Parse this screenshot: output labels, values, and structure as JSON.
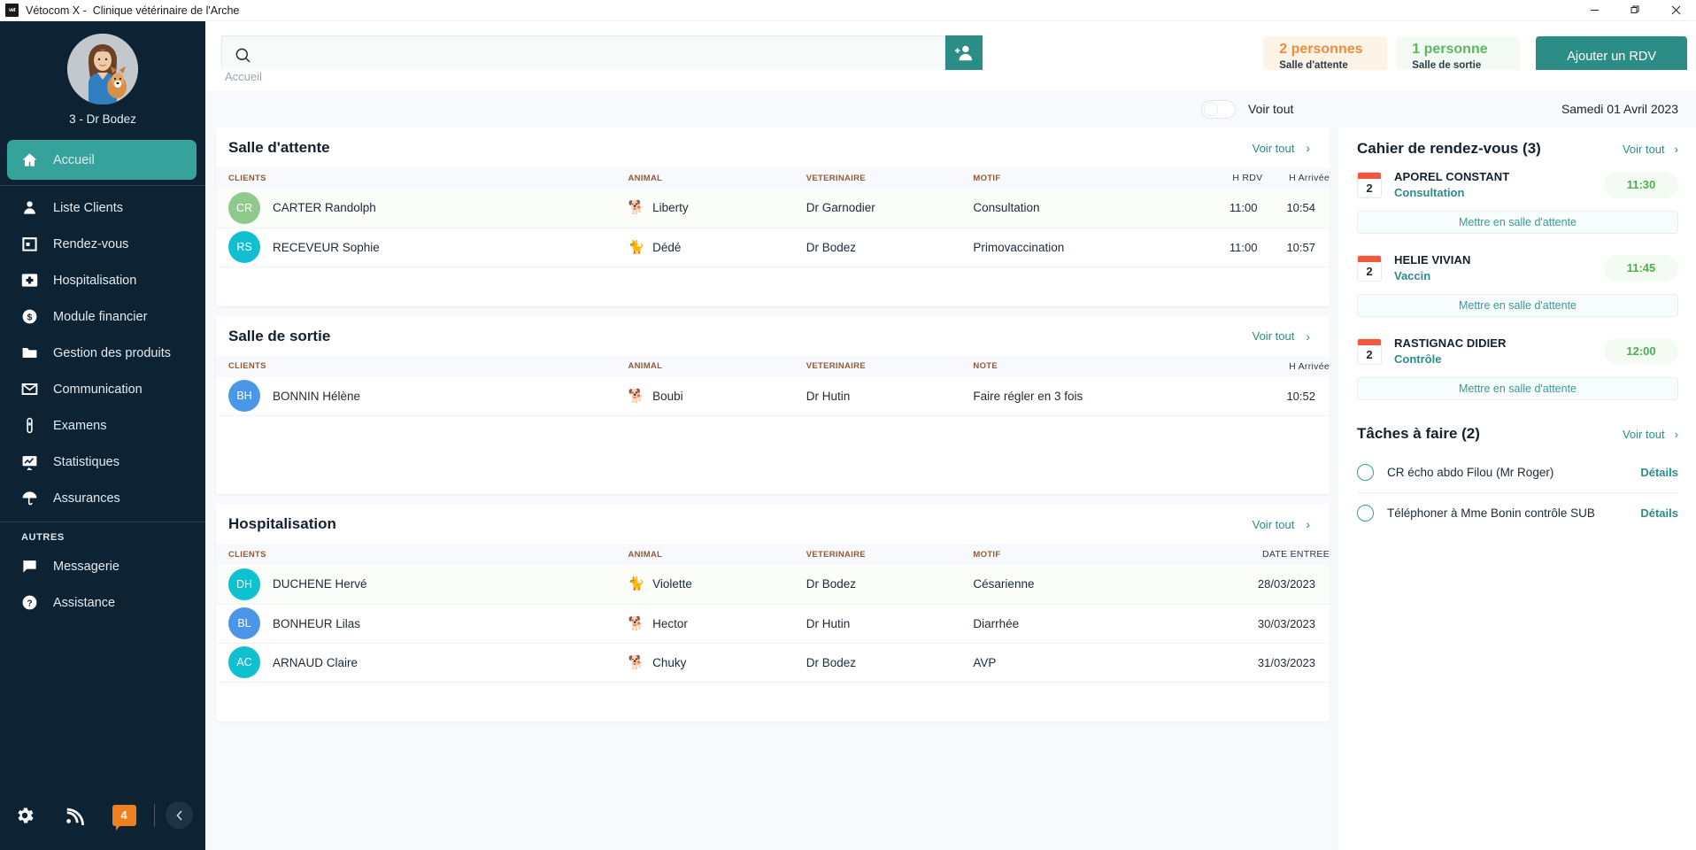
{
  "window": {
    "app_name": "Vétocom X - ",
    "clinic": "Clinique vétérinaire de l'Arche",
    "title": "Vétocom X -  Clinique vétérinaire de l'Arche",
    "logo_text": "vet",
    "minimize": "—",
    "maximize": "❐",
    "close": "✕"
  },
  "sidebar": {
    "profile": {
      "name": "3 - Dr Bodez"
    },
    "items": [
      {
        "label": "Accueil",
        "icon": "home-icon",
        "active": true
      },
      {
        "label": "Liste Clients",
        "icon": "user-icon",
        "active": false
      },
      {
        "label": "Rendez-vous",
        "icon": "calendar-icon",
        "active": false
      },
      {
        "label": "Hospitalisation",
        "icon": "first-aid-icon",
        "active": false
      },
      {
        "label": "Module financier",
        "icon": "dollar-icon",
        "active": false
      },
      {
        "label": "Gestion des produits",
        "icon": "folder-icon",
        "active": false
      },
      {
        "label": "Communication",
        "icon": "envelope-icon",
        "active": false
      },
      {
        "label": "Examens",
        "icon": "test-tube-icon",
        "active": false
      },
      {
        "label": "Statistiques",
        "icon": "chart-board-icon",
        "active": false
      },
      {
        "label": "Assurances",
        "icon": "umbrella-icon",
        "active": false
      }
    ],
    "group_label": "AUTRES",
    "other_items": [
      {
        "label": "Messagerie",
        "icon": "chat-icon"
      },
      {
        "label": "Assistance",
        "icon": "question-circle-icon"
      }
    ],
    "footer": {
      "settings_icon": "gear-icon",
      "rss_icon": "rss-icon",
      "notification_count": "4",
      "collapse_icon": "chevron-left-icon"
    }
  },
  "topbar": {
    "search": {
      "value": "",
      "placeholder": "",
      "icon": "search-icon"
    },
    "add_person_button": {
      "icon": "add-person-icon",
      "label": ""
    },
    "kpis": [
      {
        "count": "2 personnes",
        "label": "Salle d'attente",
        "color": "#ef8b3c"
      },
      {
        "count": "1 personne",
        "label": "Salle de sortie",
        "color": "#5ab860"
      }
    ],
    "primary_button": "Ajouter un RDV",
    "breadcrumb": "Accueil"
  },
  "subbar": {
    "toggle_on": false,
    "toggle_label": "Voir tout",
    "date": "Samedi 01 Avril 2023"
  },
  "sections": [
    {
      "title": "Salle d'attente",
      "voir_tout": "Voir tout",
      "columns": [
        "CLIENTS",
        "ANIMAL",
        "VETERINAIRE",
        "MOTIF",
        "H RDV",
        "H Arrivée"
      ],
      "rows": [
        {
          "initials": "CR",
          "avatar_color": "#8fc98d",
          "client": "CARTER Randolph",
          "animal": "Liberty",
          "animal_icon": "dog-icon",
          "vet": "Dr Garnodier",
          "motif": "Consultation",
          "h_rdv": "11:00",
          "h_arrivee": "10:54"
        },
        {
          "initials": "RS",
          "avatar_color": "#0fc0d0",
          "client": "RECEVEUR Sophie",
          "animal": "Dédé",
          "animal_icon": "cat-icon",
          "vet": "Dr Bodez",
          "motif": "Primovaccination",
          "h_rdv": "11:00",
          "h_arrivee": "10:57"
        }
      ]
    },
    {
      "title": "Salle de sortie",
      "voir_tout": "Voir tout",
      "columns": [
        "CLIENTS",
        "ANIMAL",
        "VETERINAIRE",
        "NOTE",
        "H Arrivée"
      ],
      "rows": [
        {
          "initials": "BH",
          "avatar_color": "#4a96e8",
          "client": "BONNIN Hélène",
          "animal": "Boubi",
          "animal_icon": "dog-icon",
          "vet": "Dr Hutin",
          "note": "Faire régler en 3 fois",
          "h_arrivee": "10:52"
        }
      ]
    },
    {
      "title": "Hospitalisation",
      "voir_tout": "Voir tout",
      "columns": [
        "CLIENTS",
        "ANIMAL",
        "VETERINAIRE",
        "MOTIF",
        "DATE ENTREE"
      ],
      "rows": [
        {
          "initials": "DH",
          "avatar_color": "#0fc0d0",
          "client": "DUCHENE Hervé",
          "animal": "Violette",
          "animal_icon": "cat-icon",
          "vet": "Dr  Bodez",
          "motif": "Césarienne",
          "date_entree": "28/03/2023"
        },
        {
          "initials": "BL",
          "avatar_color": "#4a96e8",
          "client": "BONHEUR Lilas",
          "animal": "Hector",
          "animal_icon": "dog-icon",
          "vet": "Dr  Hutin",
          "motif": "Diarrhée",
          "date_entree": "30/03/2023"
        },
        {
          "initials": "AC",
          "avatar_color": "#0fc0d0",
          "client": "ARNAUD Claire",
          "animal": "Chuky",
          "animal_icon": "dog-icon",
          "vet": "Dr  Bodez",
          "motif": "AVP",
          "date_entree": "31/03/2023"
        }
      ]
    }
  ],
  "right_panel": {
    "appointments": {
      "title": "Cahier de rendez-vous (3)",
      "voir_tout": "Voir tout",
      "items": [
        {
          "day": "2",
          "name": "APOREL CONSTANT",
          "motif": "Consultation",
          "time": "11:30",
          "action": "Mettre en salle d'attente"
        },
        {
          "day": "2",
          "name": "HELIE VIVIAN",
          "motif": "Vaccin",
          "time": "11:45",
          "action": "Mettre en salle d'attente"
        },
        {
          "day": "2",
          "name": "RASTIGNAC DIDIER",
          "motif": "Contrôle",
          "time": "12:00",
          "action": "Mettre en salle d'attente"
        }
      ]
    },
    "tasks": {
      "title": "Tâches à faire (2)",
      "voir_tout": "Voir tout",
      "items": [
        {
          "label": "CR écho abdo Filou (Mr Roger)",
          "details": "Détails"
        },
        {
          "label": "Téléphoner à Mme Bonin contrôle SUB",
          "details": "Détails"
        }
      ]
    }
  },
  "colors": {
    "sidebar_bg": "#0d2233",
    "accent_teal": "#2c8d86",
    "active_item": "#35a39b",
    "amber": "#ef8b3c",
    "green": "#5ab860",
    "calendar_red": "#f4573b"
  }
}
